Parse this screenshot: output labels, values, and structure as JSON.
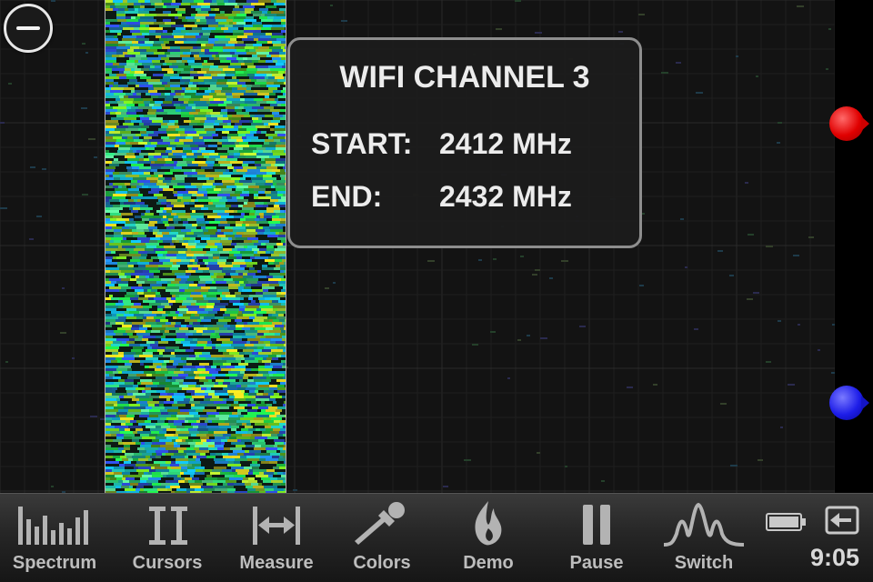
{
  "channel_popup": {
    "title": "WIFI CHANNEL 3",
    "start_label": "START:",
    "start_value": "2412 MHz",
    "end_label": "END:",
    "end_value": "2432 MHz"
  },
  "toolbar": {
    "items": [
      {
        "label": "Spectrum",
        "icon": "spectrum-bars-icon"
      },
      {
        "label": "Cursors",
        "icon": "cursors-icon"
      },
      {
        "label": "Measure",
        "icon": "measure-arrows-icon"
      },
      {
        "label": "Colors",
        "icon": "eyedropper-icon"
      },
      {
        "label": "Demo",
        "icon": "flame-icon"
      },
      {
        "label": "Pause",
        "icon": "pause-icon"
      },
      {
        "label": "Switch",
        "icon": "waveform-icon"
      }
    ]
  },
  "status": {
    "time": "9:05",
    "battery_icon": "battery-icon",
    "exit_icon": "exit-icon"
  },
  "colors": {
    "marker_upper": "#e00000",
    "marker_lower": "#1d1de8",
    "popup_border": "#8e8e8e",
    "toolbar_text": "#bdbdbd"
  }
}
